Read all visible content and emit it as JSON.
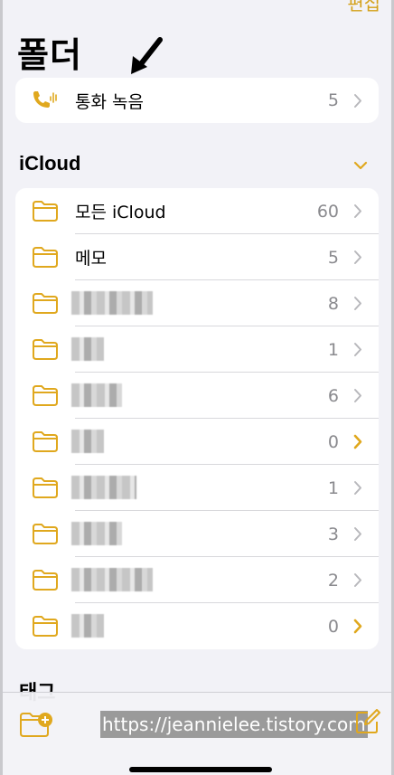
{
  "header": {
    "edit_label": "편집",
    "title": "폴더"
  },
  "call_recordings": {
    "label": "통화 녹음",
    "count": "5"
  },
  "icloud_section": {
    "title": "iCloud"
  },
  "folders": [
    {
      "label": "모든 iCloud",
      "count": "60",
      "blurred": false,
      "chevron_accent": false
    },
    {
      "label": "메모",
      "count": "5",
      "blurred": false,
      "chevron_accent": false
    },
    {
      "label": "",
      "count": "8",
      "blurred": true,
      "chevron_accent": false
    },
    {
      "label": "",
      "count": "1",
      "blurred": true,
      "chevron_accent": false
    },
    {
      "label": "",
      "count": "6",
      "blurred": true,
      "chevron_accent": false
    },
    {
      "label": "",
      "count": "0",
      "blurred": true,
      "chevron_accent": true
    },
    {
      "label": "",
      "count": "1",
      "blurred": true,
      "chevron_accent": false
    },
    {
      "label": "",
      "count": "3",
      "blurred": true,
      "chevron_accent": false
    },
    {
      "label": "",
      "count": "2",
      "blurred": true,
      "chevron_accent": false
    },
    {
      "label": "",
      "count": "0",
      "blurred": true,
      "chevron_accent": true
    }
  ],
  "tags_section": {
    "title": "태그"
  },
  "watermark": "https://jeannielee.tistory.com",
  "colors": {
    "accent": "#e0a81e",
    "secondary_text": "#8a8a8e",
    "background": "#f2f2f7"
  },
  "icons": [
    "phone-waveform-icon",
    "folder-icon",
    "chevron-right-icon",
    "chevron-down-icon",
    "new-folder-icon",
    "compose-icon",
    "arrow-annotation-icon"
  ]
}
